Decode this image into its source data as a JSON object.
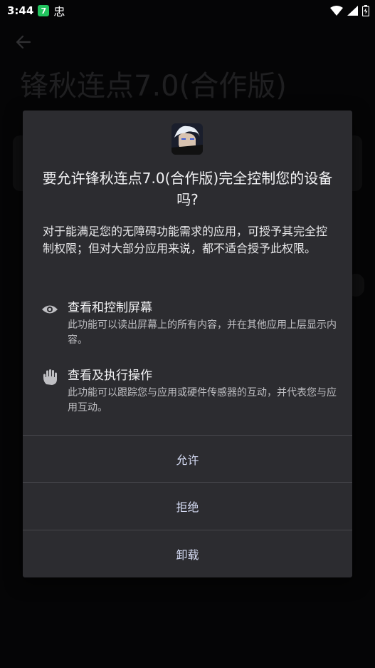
{
  "status_bar": {
    "time": "3:44",
    "app_badge": "7",
    "notification_glyph": "忠",
    "icons": [
      "wifi-icon",
      "signal-icon",
      "battery-icon"
    ]
  },
  "background_page": {
    "title": "锋秋连点7.0(合作版)"
  },
  "dialog": {
    "title": "要允许锋秋连点7.0(合作版)完全控制您的设备吗?",
    "description": "对于能满足您的无障碍功能需求的应用，可授予其完全控制权限；但对大部分应用来说，都不适合授予此权限。",
    "permissions": [
      {
        "icon": "eye-icon",
        "title": "查看和控制屏幕",
        "description": "此功能可以读出屏幕上的所有内容，并在其他应用上层显示内容。"
      },
      {
        "icon": "hand-icon",
        "title": "查看及执行操作",
        "description": "此功能可以跟踪您与应用或硬件传感器的互动，并代表您与应用互动。"
      }
    ],
    "buttons": {
      "allow": "允许",
      "deny": "拒绝",
      "uninstall": "卸载"
    }
  },
  "colors": {
    "dialog_bg": "#2c2c30",
    "button_text": "#d6dcf5",
    "divider": "#47474c"
  }
}
